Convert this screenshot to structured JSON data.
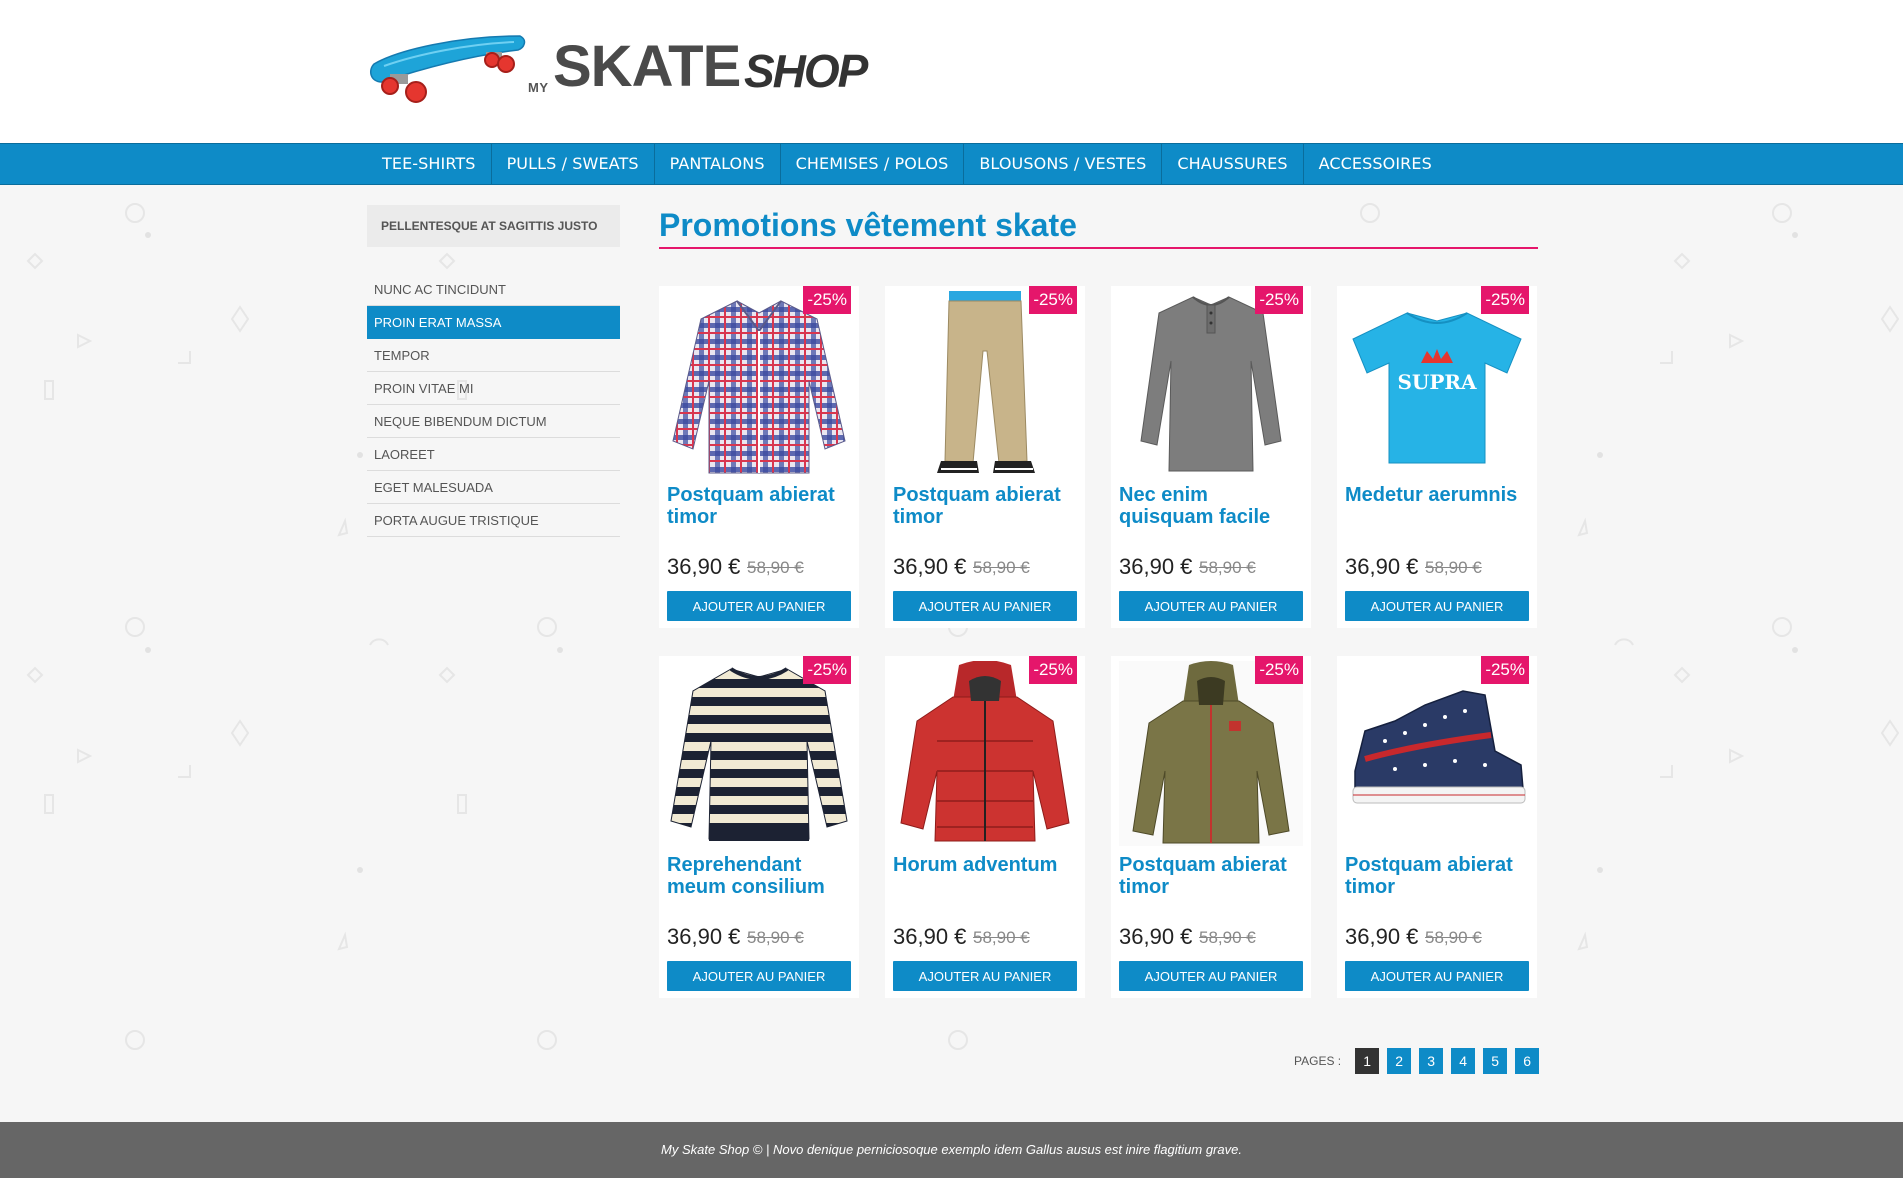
{
  "brand": {
    "my": "MY",
    "skate": "SKATE",
    "shop": "SHOP",
    "logo_icon": "skateboard-icon"
  },
  "nav": {
    "items": [
      {
        "label": "TEE-SHIRTS"
      },
      {
        "label": "PULLS / SWEATS"
      },
      {
        "label": "PANTALONS"
      },
      {
        "label": "CHEMISES / POLOS"
      },
      {
        "label": "BLOUSONS / VESTES"
      },
      {
        "label": "CHAUSSURES"
      },
      {
        "label": "ACCESSOIRES"
      }
    ]
  },
  "sidebar": {
    "title": "PELLENTESQUE AT SAGITTIS JUSTO",
    "items": [
      {
        "label": "NUNC AC TINCIDUNT",
        "active": false
      },
      {
        "label": "PROIN ERAT MASSA",
        "active": true
      },
      {
        "label": "TEMPOR",
        "active": false
      },
      {
        "label": "PROIN VITAE MI",
        "active": false
      },
      {
        "label": "NEQUE BIBENDUM DICTUM",
        "active": false
      },
      {
        "label": "LAOREET",
        "active": false
      },
      {
        "label": "EGET MALESUADA",
        "active": false
      },
      {
        "label": "PORTA AUGUE TRISTIQUE",
        "active": false
      }
    ]
  },
  "main": {
    "title": "Promotions vêtement skate",
    "products": [
      {
        "name": "Postquam abierat timor",
        "price": "36,90 €",
        "old_price": "58,90 €",
        "badge": "-25%",
        "button": "AJOUTER AU PANIER",
        "image": "plaid-shirt"
      },
      {
        "name": "Postquam abierat timor",
        "price": "36,90 €",
        "old_price": "58,90 €",
        "badge": "-25%",
        "button": "AJOUTER AU PANIER",
        "image": "khaki-pants"
      },
      {
        "name": "Nec enim quisquam facile",
        "price": "36,90 €",
        "old_price": "58,90 €",
        "badge": "-25%",
        "button": "AJOUTER AU PANIER",
        "image": "grey-henley"
      },
      {
        "name": "Medetur aerumnis",
        "price": "36,90 €",
        "old_price": "58,90 €",
        "badge": "-25%",
        "button": "AJOUTER AU PANIER",
        "image": "blue-tshirt",
        "image_text": "SUPRA"
      },
      {
        "name": "Reprehendant meum consilium",
        "price": "36,90 €",
        "old_price": "58,90 €",
        "badge": "-25%",
        "button": "AJOUTER AU PANIER",
        "image": "striped-sweater"
      },
      {
        "name": "Horum adventum",
        "price": "36,90 €",
        "old_price": "58,90 €",
        "badge": "-25%",
        "button": "AJOUTER AU PANIER",
        "image": "red-puffer-jacket"
      },
      {
        "name": "Postquam abierat timor",
        "price": "36,90 €",
        "old_price": "58,90 €",
        "badge": "-25%",
        "button": "AJOUTER AU PANIER",
        "image": "olive-hoodie"
      },
      {
        "name": "Postquam abierat timor",
        "price": "36,90 €",
        "old_price": "58,90 €",
        "badge": "-25%",
        "button": "AJOUTER AU PANIER",
        "image": "star-sneaker"
      }
    ]
  },
  "pagination": {
    "label": "PAGES :",
    "pages": [
      "1",
      "2",
      "3",
      "4",
      "5",
      "6"
    ],
    "current": "1"
  },
  "footer": {
    "text": "My Skate Shop © | Novo denique perniciosoque exemplo idem Gallus ausus est inire flagitium grave."
  },
  "colors": {
    "accent": "#0e8bc7",
    "highlight": "#e5166b",
    "footer": "#666666"
  }
}
